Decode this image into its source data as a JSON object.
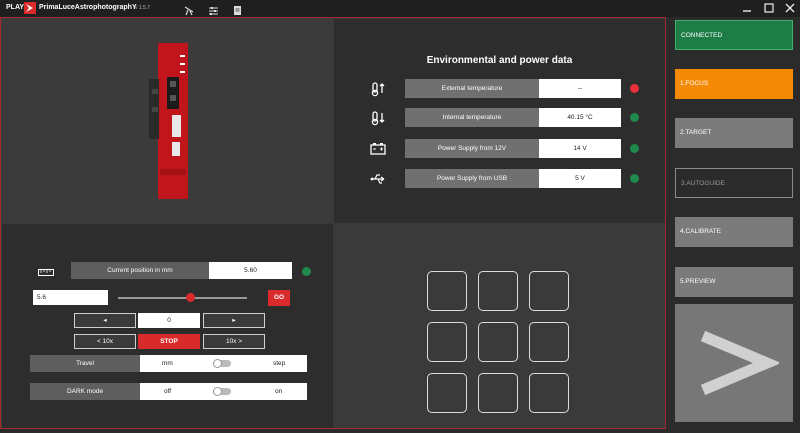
{
  "app": {
    "play_label": "PLAY",
    "brand": "PrimaLuceAstrophotographY",
    "version": "v 1.5.7"
  },
  "env": {
    "title": "Environmental and power data",
    "rows": [
      {
        "label": "External temperature",
        "value": "--",
        "status": "red",
        "icon": "thermometer-up-icon"
      },
      {
        "label": "Internal temperature",
        "value": "40.15 °C",
        "status": "green",
        "icon": "thermometer-down-icon"
      },
      {
        "label": "Power Supply from 12V",
        "value": "14 V",
        "status": "green",
        "icon": "battery-icon"
      },
      {
        "label": "Power Supply from USB",
        "value": "5 V",
        "status": "green",
        "icon": "usb-icon"
      }
    ]
  },
  "focuser": {
    "current_position_label": "Current position in mm",
    "current_position_value": "5.60",
    "target_input": "5.6",
    "slider_fraction": 0.56,
    "go_label": "GO",
    "step_left": "◂",
    "step_value": "0",
    "step_right": "▸",
    "minus10_label": "< 10x",
    "stop_label": "STOP",
    "plus10_label": "10x >",
    "travel_label": "Travel",
    "travel_left": "mm",
    "travel_right": "step",
    "dark_label": "DARK mode",
    "dark_left": "off",
    "dark_right": "on"
  },
  "sidebar": {
    "connected": "CONNECTED",
    "focus": "1.FOCUS",
    "target": "2.TARGET",
    "autoguide": "3.AUTOGUIDE",
    "calibrate": "4.CALIBRATE",
    "preview": "5.PREVIEW"
  },
  "colors": {
    "accent_red": "#d92b2b",
    "connected_green": "#1e7d47",
    "focus_orange": "#f58a07"
  }
}
